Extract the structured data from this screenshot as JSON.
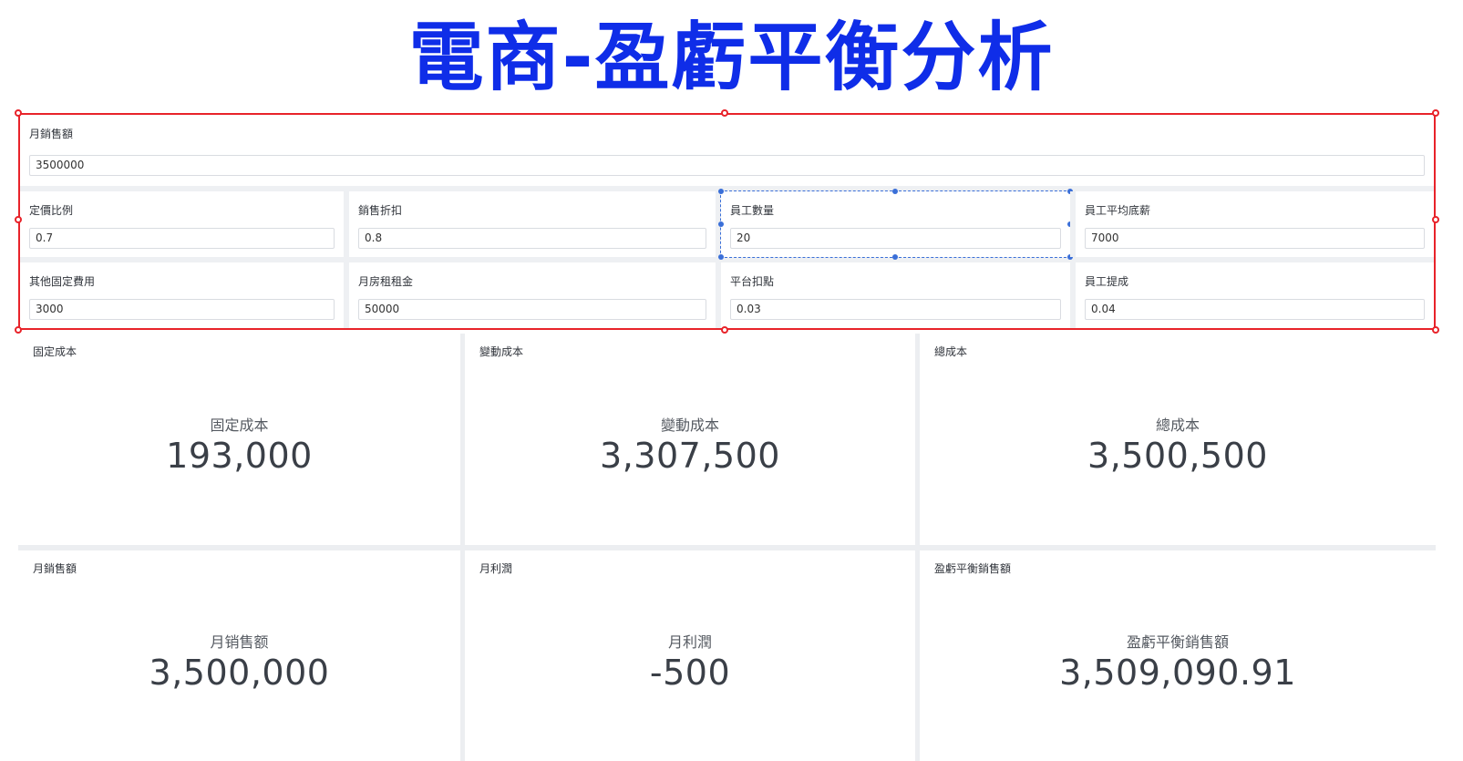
{
  "title": "電商-盈虧平衡分析",
  "inputs": {
    "monthly_sales": {
      "label": "月銷售額",
      "value": "3500000"
    },
    "pricing_ratio": {
      "label": "定價比例",
      "value": "0.7"
    },
    "sales_discount": {
      "label": "銷售折扣",
      "value": "0.8"
    },
    "employee_count": {
      "label": "員工數量",
      "value": "20"
    },
    "employee_base_salary": {
      "label": "員工平均底薪",
      "value": "7000"
    },
    "other_fixed_costs": {
      "label": "其他固定費用",
      "value": "3000"
    },
    "monthly_rent": {
      "label": "月房租租金",
      "value": "50000"
    },
    "platform_fee": {
      "label": "平台扣點",
      "value": "0.03"
    },
    "employee_commission": {
      "label": "員工提成",
      "value": "0.04"
    }
  },
  "kpis": {
    "fixed_cost": {
      "caption": "固定成本",
      "label": "固定成本",
      "value": "193,000"
    },
    "variable_cost": {
      "caption": "變動成本",
      "label": "變動成本",
      "value": "3,307,500"
    },
    "total_cost": {
      "caption": "總成本",
      "label": "總成本",
      "value": "3,500,500"
    },
    "monthly_sales": {
      "caption": "月銷售額",
      "label": "月销售额",
      "value": "3,500,000"
    },
    "monthly_profit": {
      "caption": "月利潤",
      "label": "月利潤",
      "value": "-500"
    },
    "breakeven_sales": {
      "caption": "盈虧平衡銷售額",
      "label": "盈虧平衡銷售額",
      "value": "3,509,090.91"
    }
  },
  "colors": {
    "title": "#0f2de8",
    "selection_border": "#e8232a",
    "focus_outline": "#3a6fd8"
  }
}
